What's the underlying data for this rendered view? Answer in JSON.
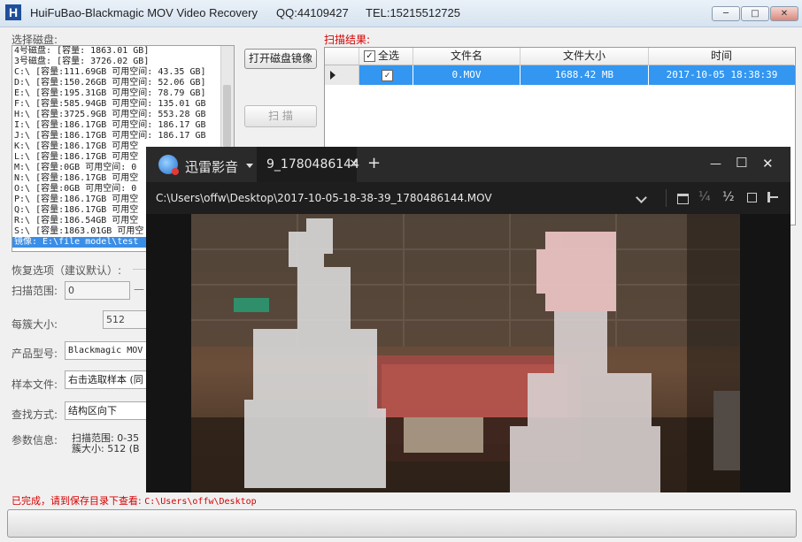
{
  "window": {
    "title": "HuiFuBao-Blackmagic MOV Video Recovery",
    "qq": "QQ:44109427",
    "tel": "TEL:15215512725",
    "minimize": "─",
    "maximize": "□",
    "close": "✕"
  },
  "disk_panel": {
    "label": "选择磁盘:",
    "items": [
      "4号磁盘: [容量: 1863.01 GB]",
      "3号磁盘: [容量: 3726.02 GB]",
      "C:\\ [容量:111.69GB 可用空间: 43.35 GB]",
      "D:\\ [容量:150.26GB 可用空间: 52.06 GB]",
      "E:\\ [容量:195.31GB 可用空间: 78.79 GB]",
      "F:\\ [容量:585.94GB 可用空间: 135.01 GB",
      "H:\\ [容量:3725.9GB 可用空间: 553.28 GB",
      "I:\\ [容量:186.17GB 可用空间: 186.17 GB",
      "J:\\ [容量:186.17GB 可用空间: 186.17 GB",
      "K:\\ [容量:186.17GB 可用空",
      "L:\\ [容量:186.17GB 可用空",
      "M:\\ [容量:0GB 可用空间: 0",
      "N:\\ [容量:186.17GB 可用空",
      "O:\\ [容量:0GB 可用空间: 0",
      "P:\\ [容量:186.17GB 可用空",
      "Q:\\ [容量:186.17GB 可用空",
      "R:\\ [容量:186.54GB 可用空",
      "S:\\ [容量:1863.01GB 可用空",
      "镜像: E:\\file model\\test"
    ],
    "selected_index": 18
  },
  "buttons": {
    "open_image": "打开磁盘镜像",
    "scan": "扫  描"
  },
  "options": {
    "group_label": "恢复选项（建议默认）:",
    "scan_range_label": "扫描范围:",
    "scan_range_value": "0",
    "scan_range_sep": "—",
    "cluster_label": "每簇大小:",
    "cluster_value": "512",
    "model_label": "产品型号:",
    "model_value": "Blackmagic MOV",
    "sample_label": "样本文件:",
    "sample_value": "右击选取样本 (同",
    "find_label": "查找方式:",
    "find_value": "结构区向下",
    "params_label": "参数信息:",
    "params_line1": "扫描范围: 0-35",
    "params_line2": "簇大小: 512 (B"
  },
  "results": {
    "label": "扫描结果:",
    "columns": [
      "全选",
      "文件名",
      "文件大小",
      "时间"
    ],
    "rows": [
      {
        "checked": true,
        "name": "0.MOV",
        "size": "1688.42 MB",
        "time": "2017-10-05 18:38:39"
      }
    ]
  },
  "status": {
    "text": "已完成，请到保存目录下查看:",
    "path": "C:\\Users\\offw\\Desktop"
  },
  "player": {
    "app_name": "迅雷影音",
    "tab_title": "9_1780486144",
    "tab_close": "×",
    "new_tab": "+",
    "path": "C:\\Users\\offw\\Desktop\\2017-10-05-18-38-39_1780486144.MOV",
    "zoom_quarter": "¼",
    "zoom_half": "½",
    "min": "—",
    "max": "☐",
    "close": "✕"
  }
}
